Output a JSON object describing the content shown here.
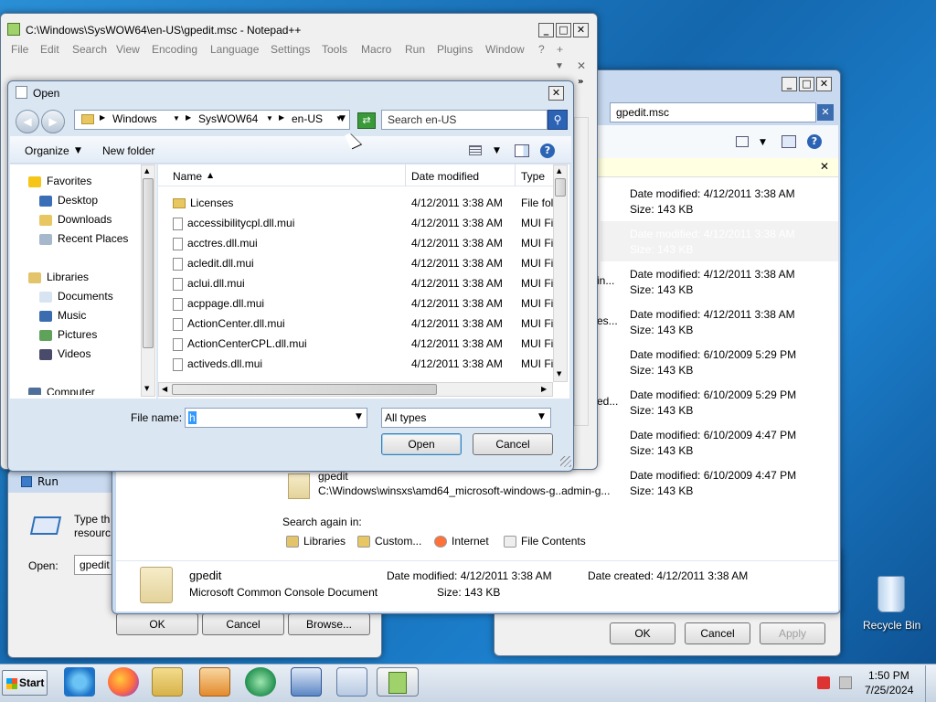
{
  "notepad": {
    "title": "C:\\Windows\\SysWOW64\\en-US\\gpedit.msc - Notepad++",
    "menu": [
      "File",
      "Edit",
      "Search",
      "View",
      "Encoding",
      "Language",
      "Settings",
      "Tools",
      "Macro",
      "Run",
      "Plugins",
      "Window",
      "?",
      "+"
    ],
    "close_x": "✕",
    "down": "▼"
  },
  "search_window": {
    "search_value": "gpedit.msc",
    "results": [
      {
        "date": "Date modified: 4/12/2011 3:38 AM",
        "size": "Size: 143 KB"
      },
      {
        "date": "Date modified: 4/12/2011 3:38 AM",
        "size": "Size: 143 KB"
      },
      {
        "date": "Date modified: 4/12/2011 3:38 AM",
        "size": "Size: 143 KB"
      },
      {
        "date": "Date modified: 4/12/2011 3:38 AM",
        "size": "Size: 143 KB"
      },
      {
        "date": "Date modified: 6/10/2009 5:29 PM",
        "size": "Size: 143 KB"
      },
      {
        "date": "Date modified: 6/10/2009 5:29 PM",
        "size": "Size: 143 KB"
      },
      {
        "date": "Date modified: 6/10/2009 4:47 PM",
        "size": "Size: 143 KB"
      },
      {
        "date": "Date modified: 6/10/2009 4:47 PM",
        "size": "Size: 143 KB"
      }
    ],
    "partial": [
      "in...",
      "es...",
      "ed..."
    ],
    "gpedit_name": "gpedit",
    "gpedit_path": "C:\\Windows\\winsxs\\amd64_microsoft-windows-g..admin-g...",
    "search_again": "Search again in:",
    "search_again_items": [
      "Libraries",
      "Custom...",
      "Internet",
      "File Contents"
    ],
    "bottom_name": "gpedit",
    "bottom_desc": "Microsoft Common Console Document",
    "bottom_date": "Date modified: 4/12/2011 3:38 AM",
    "bottom_created": "Date created: 4/12/2011 3:38 AM",
    "bottom_size": "Size: 143 KB"
  },
  "run": {
    "title": "Run",
    "desc1": "Type th",
    "desc2": "resourc",
    "open_label": "Open:",
    "open_value": "gpedit",
    "ok": "OK",
    "cancel": "Cancel",
    "browse": "Browse..."
  },
  "props": {
    "ok": "OK",
    "cancel": "Cancel",
    "apply": "Apply"
  },
  "open_dialog": {
    "title": "Open",
    "breadcrumb": [
      "Windows",
      "SysWOW64",
      "en-US"
    ],
    "search_placeholder": "Search en-US",
    "organize": "Organize",
    "new_folder": "New folder",
    "nav": {
      "favorites": "Favorites",
      "fav_items": [
        "Desktop",
        "Downloads",
        "Recent Places"
      ],
      "libraries": "Libraries",
      "lib_items": [
        "Documents",
        "Music",
        "Pictures",
        "Videos"
      ],
      "computer": "Computer"
    },
    "columns": {
      "name": "Name",
      "date": "Date modified",
      "type": "Type"
    },
    "files": [
      {
        "name": "Licenses",
        "date": "4/12/2011 3:38 AM",
        "type": "File fol",
        "folder": true
      },
      {
        "name": "accessibilitycpl.dll.mui",
        "date": "4/12/2011 3:38 AM",
        "type": "MUI Fi"
      },
      {
        "name": "acctres.dll.mui",
        "date": "4/12/2011 3:38 AM",
        "type": "MUI Fi"
      },
      {
        "name": "acledit.dll.mui",
        "date": "4/12/2011 3:38 AM",
        "type": "MUI Fi"
      },
      {
        "name": "aclui.dll.mui",
        "date": "4/12/2011 3:38 AM",
        "type": "MUI Fi"
      },
      {
        "name": "acppage.dll.mui",
        "date": "4/12/2011 3:38 AM",
        "type": "MUI Fi"
      },
      {
        "name": "ActionCenter.dll.mui",
        "date": "4/12/2011 3:38 AM",
        "type": "MUI Fi"
      },
      {
        "name": "ActionCenterCPL.dll.mui",
        "date": "4/12/2011 3:38 AM",
        "type": "MUI Fi"
      },
      {
        "name": "activeds.dll.mui",
        "date": "4/12/2011 3:38 AM",
        "type": "MUI Fi"
      }
    ],
    "file_name_label": "File name:",
    "file_name_value": "h",
    "file_type": "All types",
    "open": "Open",
    "cancel": "Cancel"
  },
  "desktop": {
    "recycle_bin": "Recycle Bin"
  },
  "taskbar": {
    "start": "Start",
    "time": "1:50 PM",
    "date": "7/25/2024"
  }
}
